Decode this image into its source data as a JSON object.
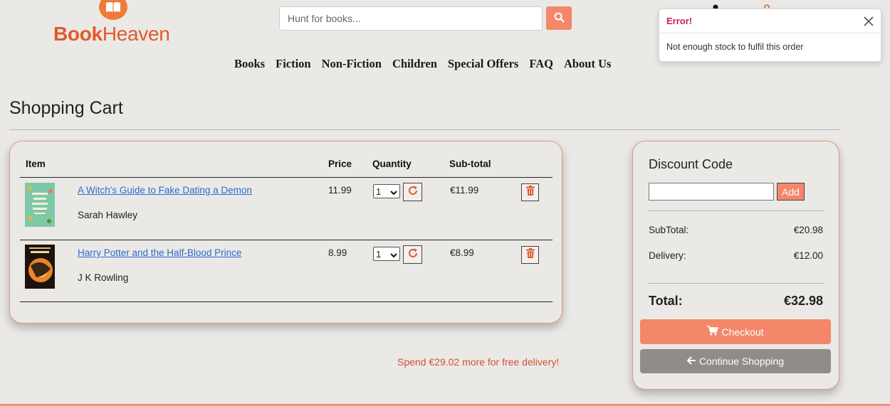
{
  "brand": {
    "name_bold": "Book",
    "name_light": "Heaven"
  },
  "search": {
    "placeholder": "Hunt for books..."
  },
  "nav": [
    "Books",
    "Fiction",
    "Non-Fiction",
    "Children",
    "Special Offers",
    "FAQ",
    "About Us"
  ],
  "toast": {
    "title": "Error!",
    "message": "Not enough stock to fulfil this order"
  },
  "page": {
    "title": "Shopping Cart"
  },
  "cart": {
    "headers": {
      "item": "Item",
      "price": "Price",
      "quantity": "Quantity",
      "subtotal": "Sub-total"
    },
    "items": [
      {
        "title": "A Witch's Guide to Fake Dating a Demon",
        "author": "Sarah Hawley",
        "price": "11.99",
        "qty": "1",
        "subtotal": "€11.99",
        "cover_color": "#7ec8a8"
      },
      {
        "title": "Harry Potter and the Half-Blood Prince",
        "author": "J K Rowling",
        "price": "8.99",
        "qty": "1",
        "subtotal": "€8.99",
        "cover_color": "#2a1a12"
      }
    ],
    "free_delivery_msg": "Spend €29.02 more for free delivery!"
  },
  "summary": {
    "title": "Discount Code",
    "add_label": "Add",
    "subtotal_label": "SubTotal:",
    "subtotal_value": "€20.98",
    "delivery_label": "Delivery:",
    "delivery_value": "€12.00",
    "total_label": "Total:",
    "total_value": "€32.98",
    "checkout_label": "Checkout",
    "continue_label": "Continue Shopping"
  },
  "colors": {
    "accent": "#f4876a",
    "brand": "#e25a2b",
    "error": "#c7254e",
    "link": "#2a6bd6"
  }
}
